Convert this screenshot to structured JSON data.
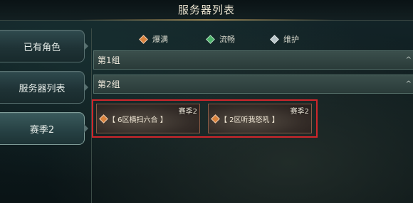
{
  "header": {
    "title": "服务器列表"
  },
  "sidebar": {
    "items": [
      {
        "label": "已有角色"
      },
      {
        "label": "服务器列表"
      },
      {
        "label": "赛季2"
      }
    ]
  },
  "legend": [
    {
      "label": "爆满",
      "icon": "diamond-icon",
      "color": "#d9823c"
    },
    {
      "label": "流畅",
      "icon": "diamond-icon",
      "color": "#4bb26a"
    },
    {
      "label": "维护",
      "icon": "diamond-icon",
      "color": "#b8c4c8"
    }
  ],
  "groups": [
    {
      "label": "第1组",
      "arrow": "^"
    },
    {
      "label": "第2组",
      "arrow": "^"
    }
  ],
  "servers": [
    {
      "name": "【 6区横扫六合 】",
      "season": "赛季2",
      "status_color": "#d9823c"
    },
    {
      "name": "【 2区听我怒吼 】",
      "season": "赛季2",
      "status_color": "#d9823c"
    }
  ]
}
